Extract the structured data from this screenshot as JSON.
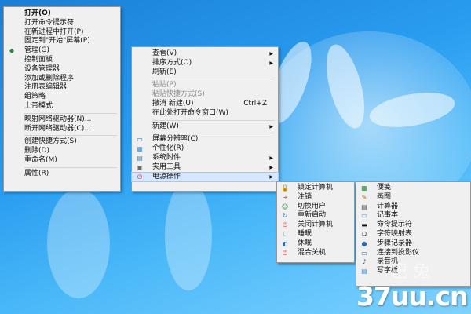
{
  "context_menu": {
    "items": [
      {
        "label": "打开(O)",
        "bold": true
      },
      {
        "label": "打开命令提示符"
      },
      {
        "label": "在新进程中打开(P)"
      },
      {
        "label": "固定到\"开始\"屏幕(P)"
      },
      {
        "label": "管理(G)",
        "icon": "shield-icon"
      },
      {
        "label": "控制面板"
      },
      {
        "label": "设备管理器"
      },
      {
        "label": "添加或删除程序"
      },
      {
        "label": "注册表编辑器"
      },
      {
        "label": "组策略"
      },
      {
        "label": "上帝模式"
      },
      {
        "separator": true
      },
      {
        "label": "映射网络驱动器(N)..."
      },
      {
        "label": "断开网络驱动器(C)..."
      },
      {
        "separator": true
      },
      {
        "label": "创建快捷方式(S)"
      },
      {
        "label": "删除(D)"
      },
      {
        "label": "重命名(M)"
      },
      {
        "separator": true
      },
      {
        "label": "属性(R)"
      }
    ]
  },
  "desktop_menu": {
    "items": [
      {
        "label": "查看(V)",
        "arrow": true
      },
      {
        "label": "排序方式(O)",
        "arrow": true
      },
      {
        "label": "刷新(E)"
      },
      {
        "separator": true
      },
      {
        "label": "粘贴(P)",
        "disabled": true
      },
      {
        "label": "粘贴快捷方式(S)",
        "disabled": true
      },
      {
        "label": "撤消 新建(U)",
        "shortcut": "Ctrl+Z"
      },
      {
        "label": "在此处打开命令窗口(W)"
      },
      {
        "separator": true
      },
      {
        "label": "新建(W)",
        "arrow": true
      },
      {
        "separator": true
      },
      {
        "label": "屏幕分辨率(C)",
        "icon": "display-icon"
      },
      {
        "label": "个性化(R)",
        "icon": "personalize-icon"
      },
      {
        "label": "系统附件",
        "icon": "accessories-icon",
        "arrow": true
      },
      {
        "label": "实用工具",
        "icon": "tools-icon",
        "arrow": true
      },
      {
        "label": "电源操作",
        "icon": "power-icon",
        "arrow": true,
        "highlight": true
      }
    ]
  },
  "power_menu": {
    "items": [
      {
        "label": "锁定计算机",
        "icon": "lock-icon"
      },
      {
        "label": "注销",
        "icon": "logoff-icon"
      },
      {
        "label": "切换用户",
        "icon": "switch-user-icon"
      },
      {
        "label": "重新启动",
        "icon": "restart-icon"
      },
      {
        "label": "关闭计算机",
        "icon": "shutdown-icon"
      },
      {
        "label": "睡眠",
        "icon": "sleep-icon"
      },
      {
        "label": "休眠",
        "icon": "hibernate-icon"
      },
      {
        "label": "混合关机",
        "icon": "hybrid-shutdown-icon"
      }
    ]
  },
  "accessories_menu": {
    "items": [
      {
        "label": "便笺",
        "icon": "sticky-notes-icon"
      },
      {
        "label": "画图",
        "icon": "paint-icon"
      },
      {
        "label": "计算器",
        "icon": "calculator-icon"
      },
      {
        "label": "记事本",
        "icon": "notepad-icon"
      },
      {
        "label": "命令提示符",
        "icon": "cmd-icon"
      },
      {
        "label": "字符映射表",
        "icon": "charmap-icon"
      },
      {
        "label": "步骤记录器",
        "icon": "steps-recorder-icon"
      },
      {
        "label": "连接到投影仪",
        "icon": "projector-icon"
      },
      {
        "label": "录音机",
        "icon": "microphone-icon"
      },
      {
        "label": "写字板",
        "icon": "wordpad-icon"
      }
    ]
  },
  "logo": {
    "text": "37uu.cn",
    "watermark": "巴兔"
  },
  "colors": {
    "menu_bg": "#f0f0f0",
    "highlight": "#d6e8ff",
    "desktop": "#2a9df0"
  }
}
